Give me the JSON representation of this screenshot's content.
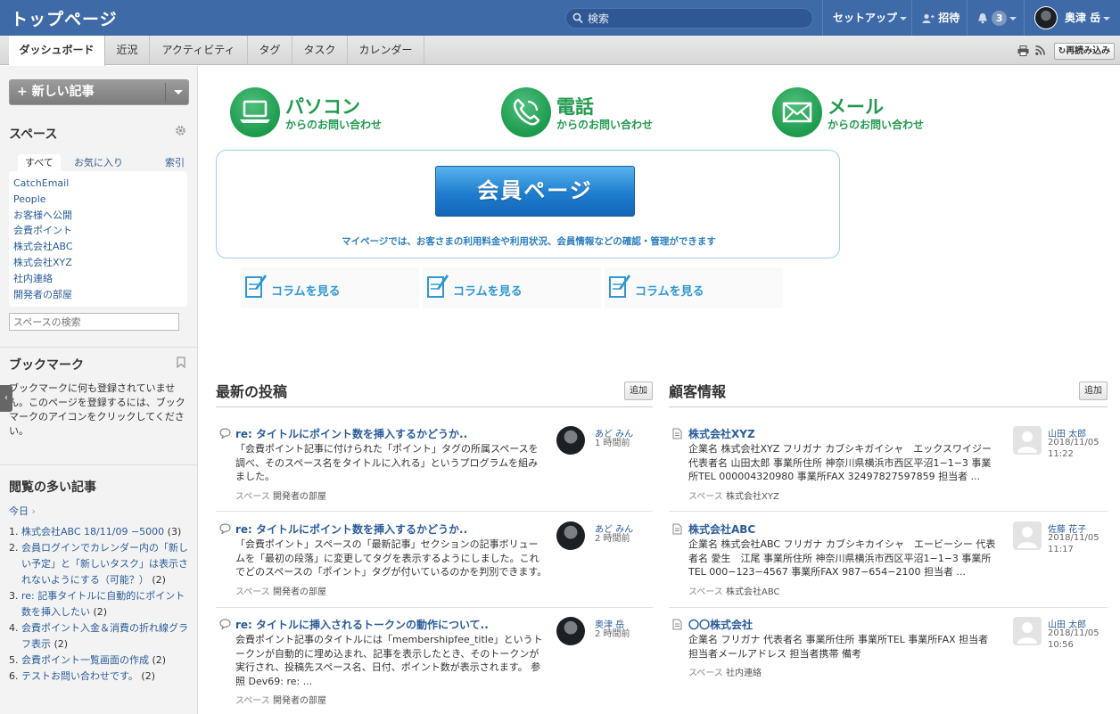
{
  "header": {
    "title": "トップページ",
    "search_placeholder": "検索",
    "setup_label": "セットアップ",
    "invite_label": "招待",
    "notification_count": "3",
    "user_name": "奥津 岳"
  },
  "tabs": [
    "ダッシュボード",
    "近況",
    "アクティビティ",
    "タグ",
    "タスク",
    "カレンダー"
  ],
  "toolbar": {
    "reload_label": "再読み込み"
  },
  "sidebar": {
    "new_post_label": "+ 新しい記事",
    "spaces_title": "スペース",
    "space_tabs": {
      "all": "すべて",
      "favorites": "お気に入り",
      "index": "索引"
    },
    "spaces": [
      "CatchEmail",
      "People",
      "お客様へ公開",
      "会費ポイント",
      "株式会社ABC",
      "株式会社XYZ",
      "社内連絡",
      "開発者の部屋"
    ],
    "space_search_placeholder": "スペースの検索",
    "bookmarks_title": "ブックマーク",
    "bookmarks_empty": "ブックマークに何も登録されていません。このページを登録するには、ブックマークのアイコンをクリックしてください。",
    "popular_title": "閲覧の多い記事",
    "popular_period": "今日",
    "popular": [
      {
        "num": "1.",
        "title": "株式会社ABC 18/11/09 −5000",
        "count": "(3)"
      },
      {
        "num": "2.",
        "title": "会員ログインでカレンダー内の「新しい予定」と「新しいタスク」は表示されないようにする（可能？）",
        "count": "(2)"
      },
      {
        "num": "3.",
        "title": "re: 記事タイトルに自動的にポイント数を挿入したい",
        "count": "(2)"
      },
      {
        "num": "4.",
        "title": "会費ポイント入金＆消費の折れ線グラフ表示",
        "count": "(2)"
      },
      {
        "num": "5.",
        "title": "会費ポイント一覧画面の作成",
        "count": "(2)"
      },
      {
        "num": "6.",
        "title": "テストお問い合わせです。",
        "count": "(2)"
      }
    ]
  },
  "banner": {
    "contacts": [
      {
        "big": "パソコン",
        "small": "からのお問い合わせ",
        "icon": "laptop-icon"
      },
      {
        "big": "電話",
        "small": "からのお問い合わせ",
        "icon": "phone-icon"
      },
      {
        "big": "メール",
        "small": "からのお問い合わせ",
        "icon": "mail-icon"
      }
    ],
    "member_button": "会員ページ",
    "member_desc": "マイページでは、お客さまの利用料金や利用状況、会員情報などの確認・管理ができます",
    "column_label": "コラムを見る"
  },
  "posts": {
    "title": "最新の投稿",
    "add_label": "追加",
    "space_prefix": "スペース",
    "items": [
      {
        "title": "re: タイトルにポイント数を挿入するかどうか..",
        "body": "「会費ポイント記事に付けられた「ポイント」タグの所属スペースを調べ、そのスペース名をタイトルに入れる」というプログラムを組みました。",
        "space": "開発者の部屋",
        "author": "あど みん",
        "time": "1 時間前"
      },
      {
        "title": "re: タイトルにポイント数を挿入するかどうか..",
        "body": "「会費ポイント」スペースの「最新記事」セクションの記事ボリュームを「最初の段落」に変更してタグを表示するようにしました。これでどのスペースの「ポイント」タグが付いているのかを判別できます。",
        "space": "開発者の部屋",
        "author": "あど みん",
        "time": "2 時間前"
      },
      {
        "title": "re: タイトルに挿入されるトークンの動作について..",
        "body": "会費ポイント記事のタイトルには「membershipfee_title」というトークンが自動的に埋め込まれ、記事を表示したとき、そのトークンが実行され、投稿先スペース名、日付、ポイント数が表示されます。 参照 Dev69: re: ...",
        "space": "開発者の部屋",
        "author": "奥津 岳",
        "time": "2 時間前"
      }
    ]
  },
  "customers": {
    "title": "顧客情報",
    "add_label": "追加",
    "space_prefix": "スペース",
    "items": [
      {
        "title": "株式会社XYZ",
        "body": "企業名 株式会社XYZ フリガナ カブシキガイシャ　エックスワイジー 代表者名 山田太郎 事業所住所 神奈川県横浜市西区平沼1−1−3 事業所TEL 000004320980 事業所FAX 32497827597859 担当者 ...",
        "space": "株式会社XYZ",
        "author": "山田 太郎",
        "date": "2018/11/05",
        "time": "11:22"
      },
      {
        "title": "株式会社ABC",
        "body": "企業名 株式会社ABC フリガナ カブシキカイシャ　エービーシー 代表者名 愛生　江尾 事業所住所 神奈川県横浜市西区平沼1−1−3 事業所TEL 000−123−4567 事業所FAX 987−654−2100 担当者 ...",
        "space": "株式会社ABC",
        "author": "佐藤 花子",
        "date": "2018/11/05",
        "time": "11:17"
      },
      {
        "title": "〇〇株式会社",
        "body": "企業名 フリガナ 代表者名 事業所住所 事業所TEL 事業所FAX 担当者 担当者メールアドレス 担当者携帯 備考",
        "space": "社内連絡",
        "author": "山田 太郎",
        "date": "2018/11/05",
        "time": "10:56"
      }
    ]
  },
  "colors": {
    "header": "#3f6aa8",
    "brand_green": "#229a4f",
    "member_blue": "#1e7dcf",
    "link": "#2a5c9a"
  }
}
